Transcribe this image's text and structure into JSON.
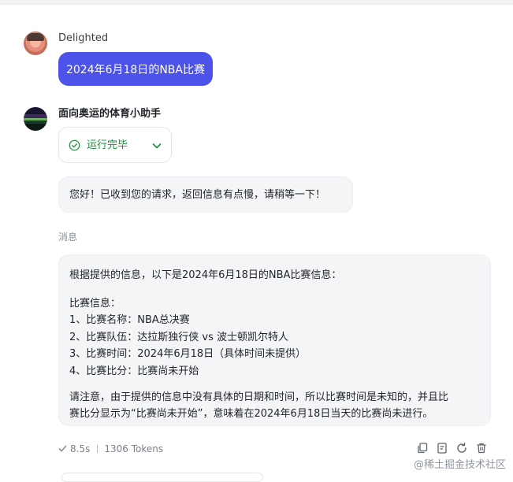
{
  "user": {
    "name": "Delighted",
    "message": "2024年6月18日的NBA比赛"
  },
  "bot": {
    "name": "面向奥运的体育小助手",
    "run_status": "运行完毕",
    "reply": "您好！已收到您的请求，返回信息有点慢，请稍等一下！"
  },
  "section_label": "消息",
  "message": {
    "intro": "根据提供的信息，以下是2024年6月18日的NBA比赛信息：",
    "heading": "比赛信息：",
    "items": [
      "1、比赛名称：NBA总决赛",
      "2、比赛队伍：达拉斯独行侠 vs 波士顿凯尔特人",
      "3、比赛时间：2024年6月18日（具体时间未提供）",
      "4、比赛比分：比赛尚未开始"
    ],
    "note_line1": "请注意，由于提供的信息中没有具体的日期和时间，所以比赛时间是未知的，并且比",
    "note_line2": "赛比分显示为“比赛尚未开始”，意味着在2024年6月18日当天的比赛尚未进行。"
  },
  "footer": {
    "duration": "8.5s",
    "tokens": "1306 Tokens"
  },
  "actions": [
    "copy-icon",
    "note-icon",
    "refresh-icon",
    "trash-icon"
  ],
  "watermark": "@稀土掘金技术社区",
  "colors": {
    "accent": "#4d53e8",
    "success": "#1a8d3c",
    "bubble_bg": "#f4f5f7"
  }
}
